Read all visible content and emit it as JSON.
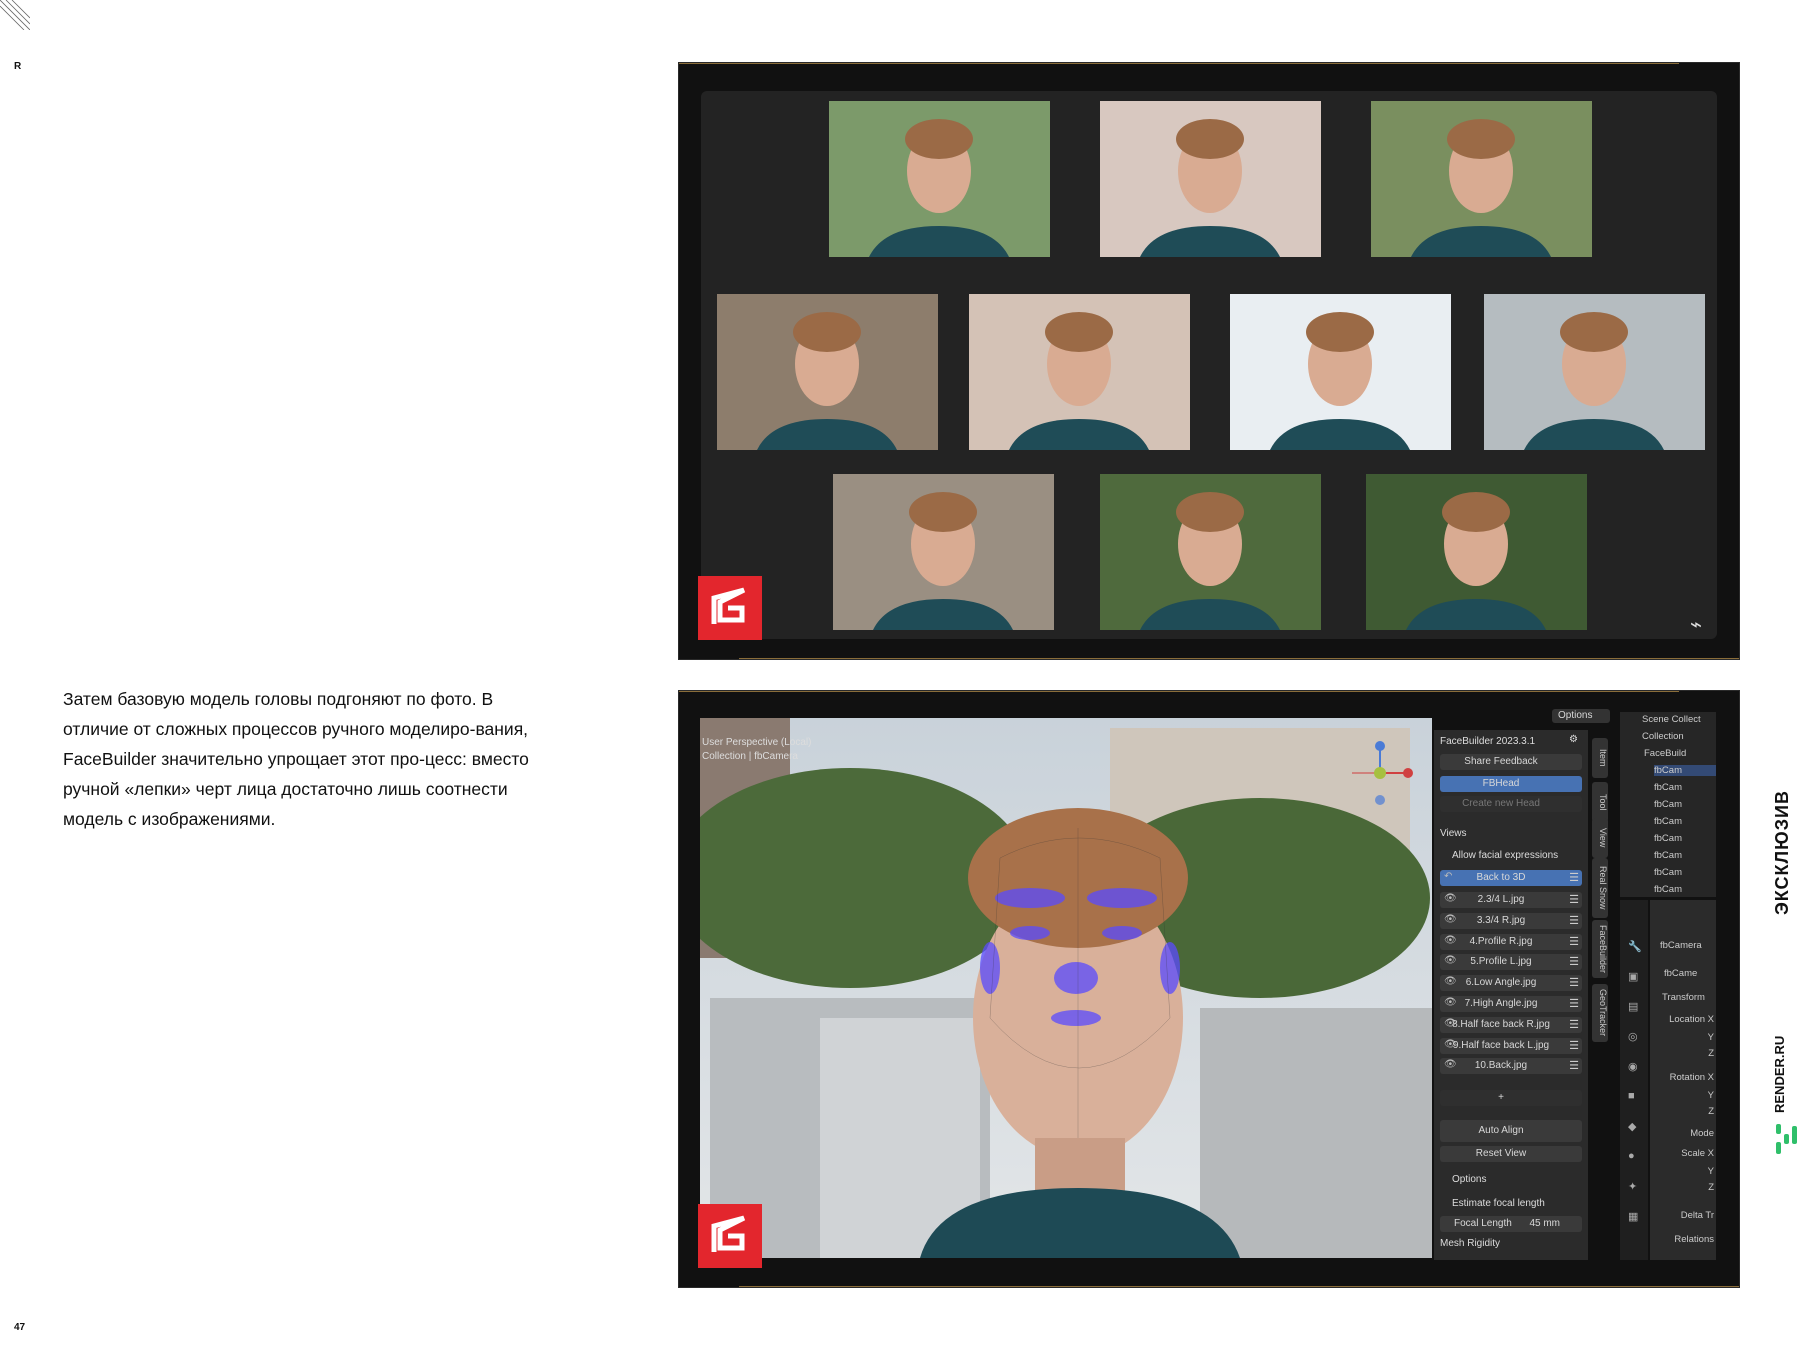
{
  "page": {
    "letter": "R",
    "number": "47",
    "body_text": "Затем базовую модель головы подгоняют по фото. В отличие от сложных процессов ручного моделиро-вания, FaceBuilder значительно упрощает этот про-цесс: вместо ручной «лепки» черт лица достаточно лишь соотнести модель с изображениями.",
    "side_label": "ЭКСКЛЮЗИВ",
    "brand": "RENDER.RU"
  },
  "viewport": {
    "perspective_label": "User Perspective (Local)",
    "collection_label": "Collection | fbCamera"
  },
  "facebuilder": {
    "title": "FaceBuilder 2023.3.1",
    "share_feedback": "Share Feedback",
    "head_name": "FBHead",
    "create_new_head": "Create new Head",
    "views_header": "Views",
    "allow_facial": "Allow facial expressions",
    "back_to_3d": "Back to 3D",
    "views": [
      "2.3/4 L.jpg",
      "3.3/4 R.jpg",
      "4.Profile R.jpg",
      "5.Profile L.jpg",
      "6.Low Angle.jpg",
      "7.High Angle.jpg",
      "8.Half face back R.jpg",
      "9.Half face back L.jpg",
      "10.Back.jpg"
    ],
    "add": "+",
    "auto_align": "Auto Align",
    "reset_view": "Reset View",
    "options_header": "Options",
    "estimate_focal": "Estimate focal length",
    "focal_label": "Focal Length",
    "focal_value": "45 mm",
    "mesh_rigidity": "Mesh Rigidity",
    "options_top": "Options"
  },
  "side_tabs": [
    "Item",
    "Tool",
    "View",
    "Real Snow",
    "FaceBuilder",
    "GeoTracker"
  ],
  "outliner": {
    "items": [
      "Scene Collect",
      "Collection",
      "FaceBuild",
      "fbCam",
      "fbCam",
      "fbCam",
      "fbCam",
      "fbCam",
      "fbCam",
      "fbCam",
      "fbCam"
    ]
  },
  "properties": {
    "object": "fbCamera",
    "data": "fbCame",
    "transform": "Transform",
    "location_x": "Location X",
    "y": "Y",
    "z": "Z",
    "rotation_x": "Rotation X",
    "mode": "Mode",
    "scale_x": "Scale X",
    "delta": "Delta Tr",
    "relations": "Relations"
  },
  "colors": {
    "logo_red": "#e3262d",
    "blender_blue": "#4772b3",
    "mesh_purple": "#6a4bff",
    "brand_green": "#2fbf6a"
  }
}
